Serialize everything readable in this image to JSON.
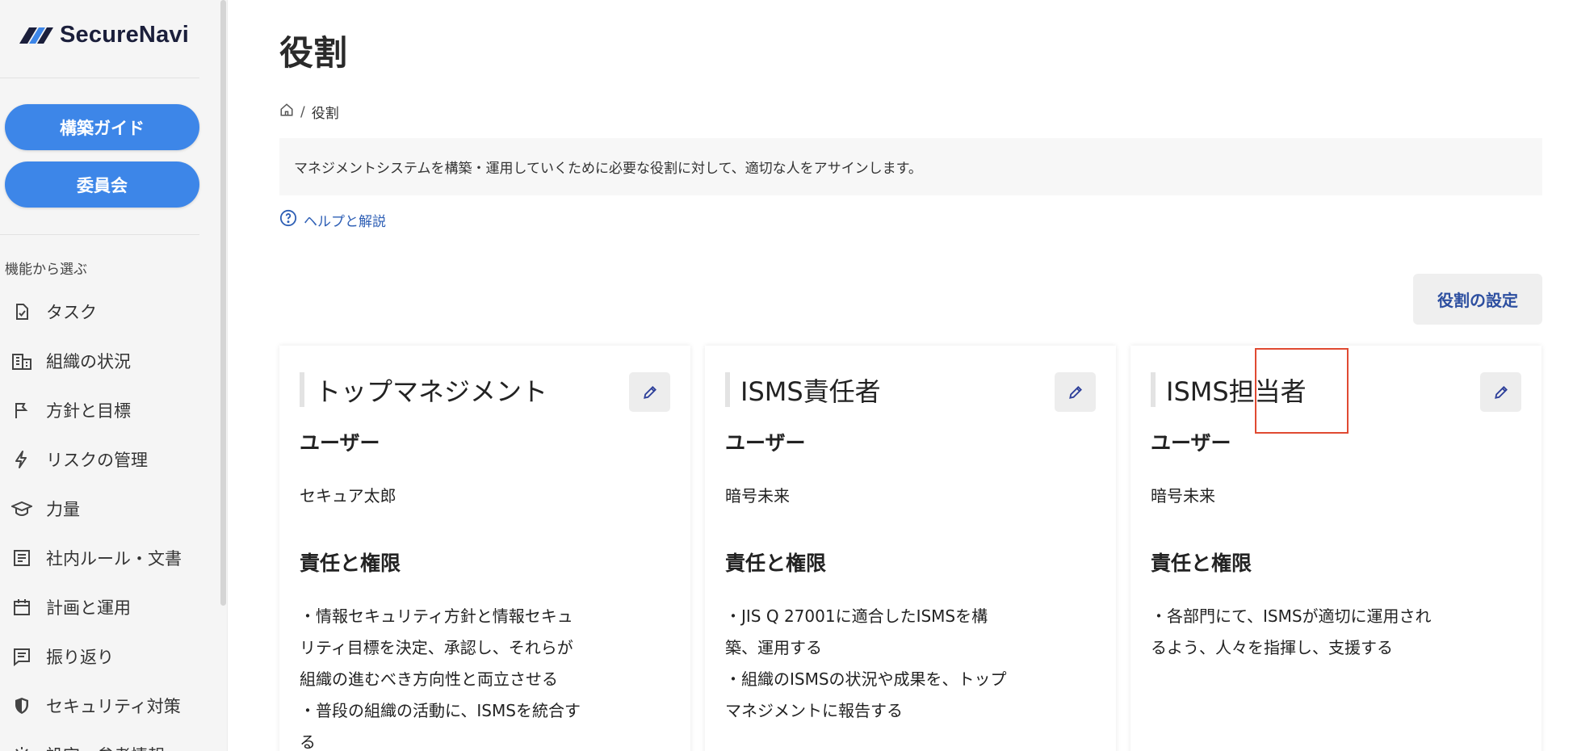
{
  "sidebar": {
    "logo_text": "SecureNavi",
    "buttons": [
      {
        "label": "構築ガイド"
      },
      {
        "label": "委員会"
      }
    ],
    "section_label": "機能から選ぶ",
    "items": [
      {
        "label": "タスク",
        "icon": "task-doc-icon"
      },
      {
        "label": "組織の状況",
        "icon": "building-icon"
      },
      {
        "label": "方針と目標",
        "icon": "flag-icon"
      },
      {
        "label": "リスクの管理",
        "icon": "lightning-icon"
      },
      {
        "label": "力量",
        "icon": "graduation-cap-icon"
      },
      {
        "label": "社内ルール・文書",
        "icon": "document-icon"
      },
      {
        "label": "計画と運用",
        "icon": "calendar-icon"
      },
      {
        "label": "振り返り",
        "icon": "review-icon"
      },
      {
        "label": "セキュリティ対策",
        "icon": "shield-icon"
      },
      {
        "label": "設定・参考情報",
        "icon": "gear-icon"
      }
    ]
  },
  "main": {
    "title": "役割",
    "breadcrumb": {
      "separator": "/",
      "current": "役割"
    },
    "description": "マネジメントシステムを構築・運用していくために必要な役割に対して、適切な人をアサインします。",
    "help_link": "ヘルプと解説",
    "role_settings_button": "役割の設定",
    "user_heading": "ユーザー",
    "responsibility_heading": "責任と権限",
    "cards": [
      {
        "title": "トップマネジメント",
        "user": "セキュア太郎",
        "responsibilities": "・情報セキュリティ方針と情報セキュ\nリティ目標を決定、承認し、それらが\n組織の進むべき方向性と両立させる\n・普段の組織の活動に、ISMSを統合す\nる"
      },
      {
        "title": "ISMS責任者",
        "user": "暗号未来",
        "responsibilities": "・JIS Q 27001に適合したISMSを構\n築、運用する\n・組織のISMSの状況や成果を、トップ\nマネジメントに報告する"
      },
      {
        "title": "ISMS担当者",
        "user": "暗号未来",
        "responsibilities": "・各部門にて、ISMSが適切に運用され\nるよう、人々を指揮し、支援する"
      }
    ]
  },
  "colors": {
    "primary_button": "#3d86e8",
    "link": "#2e5fb5",
    "highlight": "#e04a32"
  }
}
